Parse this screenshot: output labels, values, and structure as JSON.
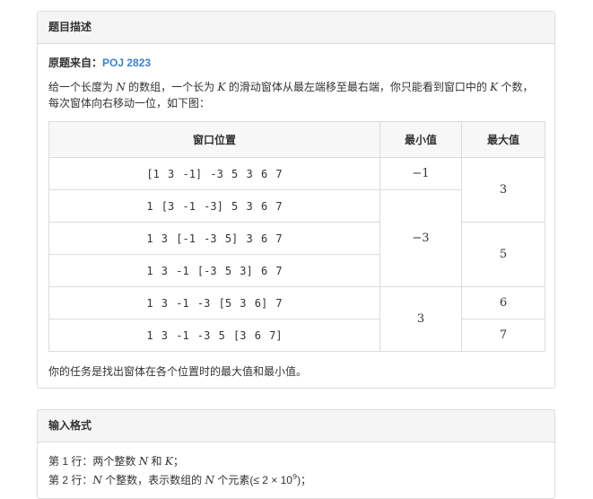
{
  "problem": {
    "section_title": "题目描述",
    "source_label": "原题来自：",
    "source_link": "POJ 2823",
    "desc_p1": "给一个长度为 ",
    "desc_N": "N",
    "desc_p2": " 的数组，一个长为 ",
    "desc_K": "K",
    "desc_p3": " 的滑动窗体从最左端移至最右端，你只能看到窗口中的 ",
    "desc_K2": "K",
    "desc_p4": " 个数，每次窗体向右移动一位，如下图：",
    "table": {
      "headers": [
        "窗口位置",
        "最小值",
        "最大值"
      ],
      "windows": [
        "[1  3  -1] -3  5  3  6  7",
        "1 [3  -1  -3] 5  3  6  7",
        "1  3 [-1  -3  5] 3  6  7",
        "1  3  -1 [-3  5  3] 6  7",
        "1  3  -1  -3 [5  3  6] 7",
        "1  3  -1  -3  5 [3  6  7]"
      ],
      "min_values": [
        "−1",
        "−3",
        "3"
      ],
      "max_values": [
        "3",
        "5",
        "6",
        "7"
      ]
    },
    "task": "你的任务是找出窗体在各个位置时的最大值和最小值。"
  },
  "input_format": {
    "section_title": "输入格式",
    "line1_a": "第 1 行：两个整数 ",
    "line1_N": "N",
    "line1_b": " 和 ",
    "line1_K": "K",
    "line1_c": "；",
    "line2_a": "第 2 行：",
    "line2_N": "N",
    "line2_b": " 个整数，表示数组的 ",
    "line2_N2": "N",
    "line2_c": " 个元素(≤ 2 × 10",
    "line2_exp": "9",
    "line2_d": ")；"
  }
}
